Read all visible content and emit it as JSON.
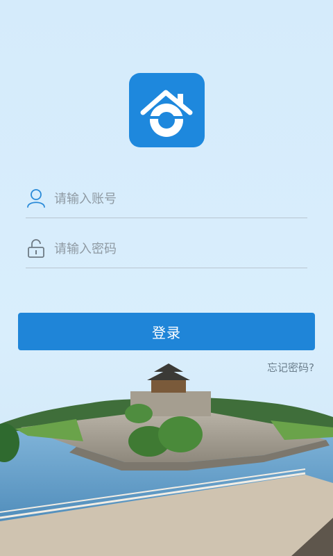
{
  "logo": {
    "icon": "house-camera-icon",
    "bg_color": "#1e88dd"
  },
  "form": {
    "account_placeholder": "请输入账号",
    "account_icon": "user-icon",
    "password_placeholder": "请输入密码",
    "password_icon": "lock-icon",
    "login_label": "登录",
    "forgot_label": "忘记密码?"
  },
  "colors": {
    "accent": "#1f85d8",
    "background": "#d6ecfb"
  },
  "illustration": {
    "name": "city-wall-tower-scene"
  }
}
